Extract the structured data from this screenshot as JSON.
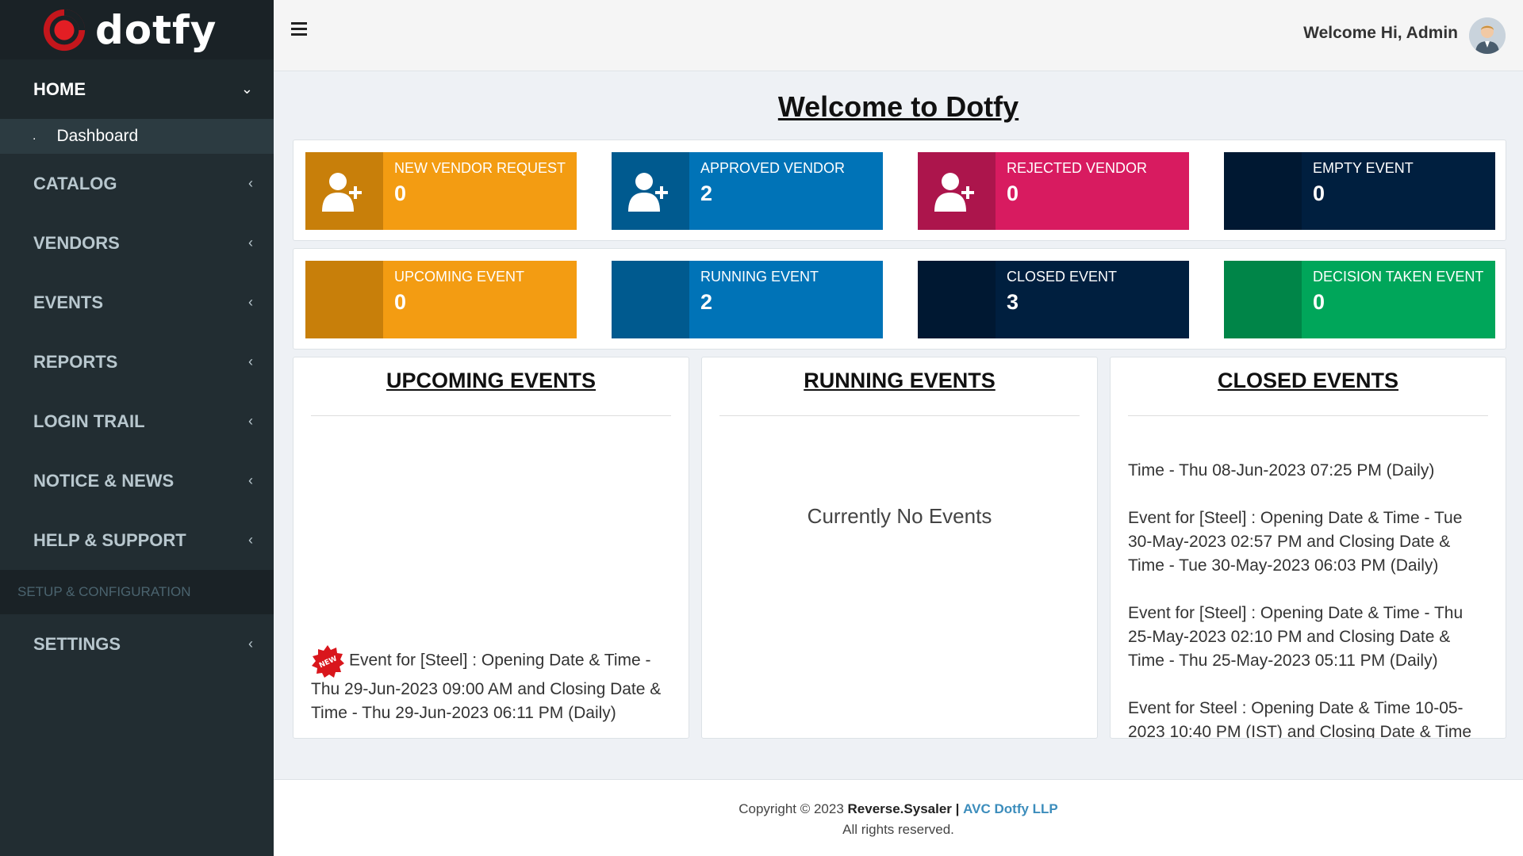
{
  "brand": {
    "name": "dotfy"
  },
  "sidebar": {
    "home": {
      "label": "HOME",
      "submenu": [
        {
          "label": "Dashboard"
        }
      ]
    },
    "items": [
      {
        "label": "CATALOG"
      },
      {
        "label": "VENDORS"
      },
      {
        "label": "EVENTS"
      },
      {
        "label": "REPORTS"
      },
      {
        "label": "LOGIN TRAIL"
      },
      {
        "label": "NOTICE & NEWS"
      },
      {
        "label": "HELP & SUPPORT"
      }
    ],
    "section_header": "SETUP & CONFIGURATION",
    "settings": {
      "label": "SETTINGS"
    }
  },
  "topbar": {
    "welcome": "Welcome Hi, Admin"
  },
  "page": {
    "title": "Welcome to Dotfy"
  },
  "stats": {
    "row1": [
      {
        "label": "NEW VENDOR REQUEST",
        "value": "0",
        "color": "#f39c12",
        "icon": "add-user-icon"
      },
      {
        "label": "APPROVED VENDOR",
        "value": "2",
        "color": "#0073b7",
        "icon": "add-user-icon"
      },
      {
        "label": "REJECTED VENDOR",
        "value": "0",
        "color": "#d81b60",
        "icon": "add-user-icon"
      },
      {
        "label": "EMPTY EVENT",
        "value": "0",
        "color": "#001f3f",
        "icon": ""
      }
    ],
    "row2": [
      {
        "label": "UPCOMING EVENT",
        "value": "0",
        "color": "#f39c12"
      },
      {
        "label": "RUNNING EVENT",
        "value": "2",
        "color": "#0073b7"
      },
      {
        "label": "CLOSED EVENT",
        "value": "3",
        "color": "#001f3f"
      },
      {
        "label": "DECISION TAKEN EVENT",
        "value": "0",
        "color": "#00a65a"
      }
    ]
  },
  "panels": {
    "upcoming": {
      "title": "UPCOMING EVENTS",
      "event": "Event for [Steel] : Opening Date & Time - Thu 29-Jun-2023 09:00 AM and Closing Date & Time - Thu 29-Jun-2023 06:11 PM (Daily)",
      "badge": "NEW"
    },
    "running": {
      "title": "RUNNING EVENTS",
      "empty": "Currently No Events"
    },
    "closed": {
      "title": "CLOSED EVENTS",
      "items": [
        "Time - Thu 08-Jun-2023 07:25 PM (Daily)",
        "Event for [Steel] : Opening Date & Time - Tue 30-May-2023 02:57 PM and Closing Date & Time - Tue 30-May-2023 06:03 PM (Daily)",
        "Event for [Steel] : Opening Date & Time - Thu 25-May-2023 02:10 PM and Closing Date & Time - Thu 25-May-2023 05:11 PM (Daily)",
        "Event for Steel : Opening Date & Time 10-05-2023 10:40 PM (IST) and Closing Date & Time"
      ]
    }
  },
  "footer": {
    "copyright": "Copyright © 2023",
    "company": "Reverse.Sysaler",
    "separator": "|",
    "partner": "AVC Dotfy LLP",
    "rights": "All rights reserved."
  }
}
